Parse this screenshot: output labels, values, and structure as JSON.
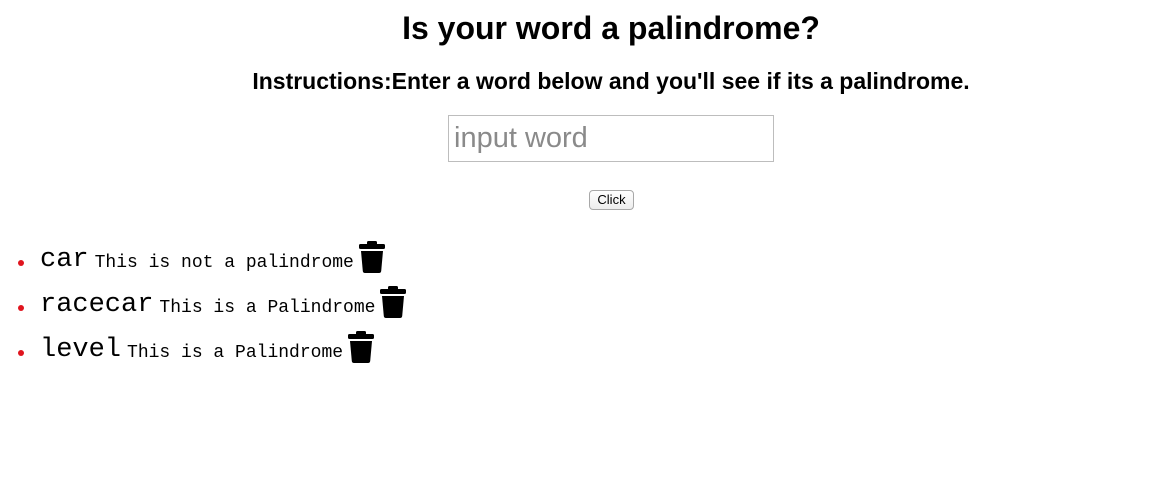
{
  "header": {
    "title": "Is your word a palindrome?",
    "instructions": "Instructions:Enter a word below and you'll see if its a palindrome."
  },
  "form": {
    "input_value": "",
    "input_placeholder": "input word",
    "button_label": "Click"
  },
  "results": [
    {
      "word": "car",
      "verdict": "This is not a palindrome",
      "icon": "trash-icon"
    },
    {
      "word": "racecar",
      "verdict": "This is a Palindrome",
      "icon": "trash-icon"
    },
    {
      "word": "level",
      "verdict": "This is a Palindrome",
      "icon": "trash-icon"
    }
  ],
  "colors": {
    "bullet": "#e0141e",
    "text": "#000000",
    "background": "#ffffff"
  }
}
